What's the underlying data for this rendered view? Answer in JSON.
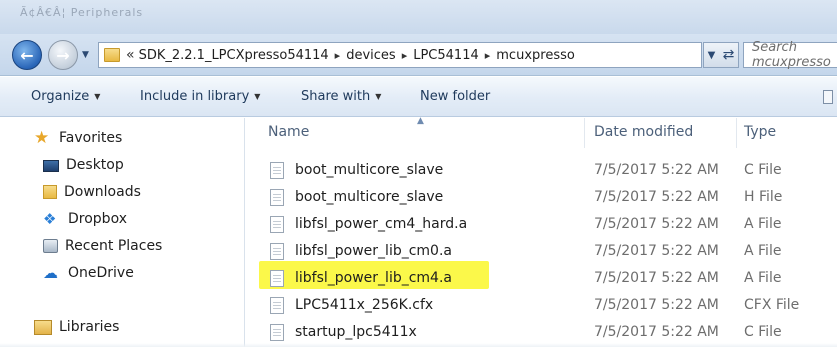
{
  "window": {
    "title_ghost": "Ã¢Â€Â¦ Peripherals"
  },
  "address": {
    "chevron": "«",
    "breadcrumbs": [
      "SDK_2.2.1_LPCXpresso54114",
      "devices",
      "LPC54114",
      "mcuxpresso"
    ],
    "separator": "▸"
  },
  "search": {
    "placeholder": "Search mcuxpresso"
  },
  "toolbar": {
    "organize": "Organize",
    "include_in_library": "Include in library",
    "share_with": "Share with",
    "new_folder": "New folder"
  },
  "nav": {
    "favorites": "Favorites",
    "desktop": "Desktop",
    "downloads": "Downloads",
    "dropbox": "Dropbox",
    "recent_places": "Recent Places",
    "onedrive": "OneDrive",
    "libraries": "Libraries"
  },
  "columns": {
    "name": "Name",
    "date_modified": "Date modified",
    "type": "Type"
  },
  "files": [
    {
      "name": "boot_multicore_slave",
      "date": "7/5/2017 5:22 AM",
      "type": "C File"
    },
    {
      "name": "boot_multicore_slave",
      "date": "7/5/2017 5:22 AM",
      "type": "H File"
    },
    {
      "name": "libfsl_power_cm4_hard.a",
      "date": "7/5/2017 5:22 AM",
      "type": "A File"
    },
    {
      "name": "libfsl_power_lib_cm0.a",
      "date": "7/5/2017 5:22 AM",
      "type": "A File"
    },
    {
      "name": "libfsl_power_lib_cm4.a",
      "date": "7/5/2017 5:22 AM",
      "type": "A File"
    },
    {
      "name": "LPC5411x_256K.cfx",
      "date": "7/5/2017 5:22 AM",
      "type": "CFX File"
    },
    {
      "name": "startup_lpc5411x",
      "date": "7/5/2017 5:22 AM",
      "type": "C File"
    }
  ],
  "colors": {
    "highlight": "#fbf84a",
    "toolbar_text": "#1e395b"
  }
}
